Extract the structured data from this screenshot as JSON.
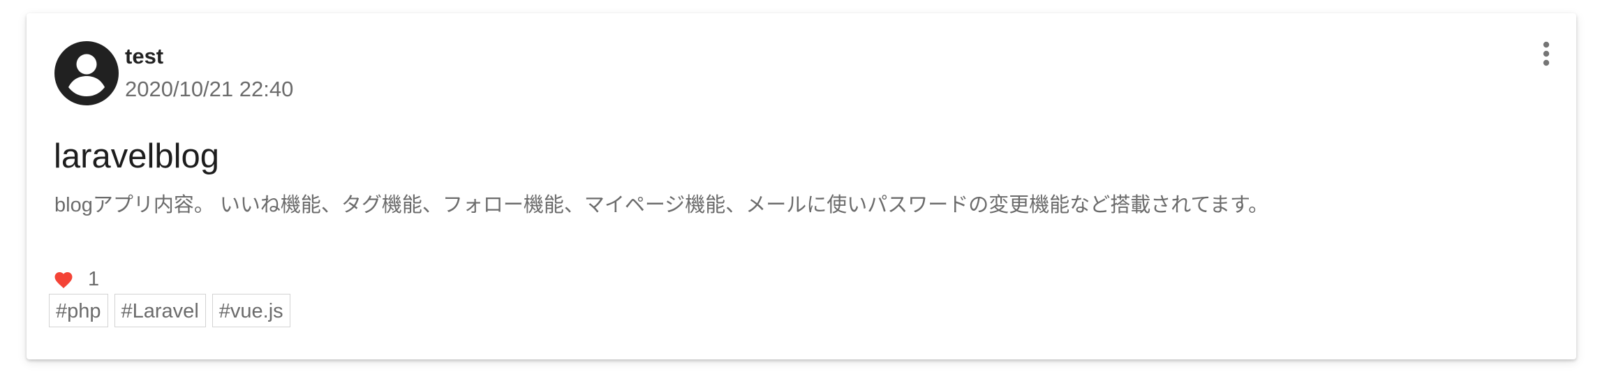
{
  "post": {
    "user_name": "test",
    "date": "2020/10/21 22:40",
    "title": "laravelblog",
    "body": "blogアプリ内容。 いいね機能、タグ機能、フォロー機能、マイページ機能、メールに使いパスワードの変更機能など搭載されてます。",
    "like_count": "1",
    "tags": [
      "#php",
      "#Laravel",
      "#vue.js"
    ]
  },
  "icons": {
    "avatar": "account-circle-icon",
    "more": "dots-vertical-icon",
    "like": "heart-icon"
  },
  "colors": {
    "heart": "#f44336",
    "avatar": "#212121",
    "text_secondary": "#6b6b6b"
  }
}
